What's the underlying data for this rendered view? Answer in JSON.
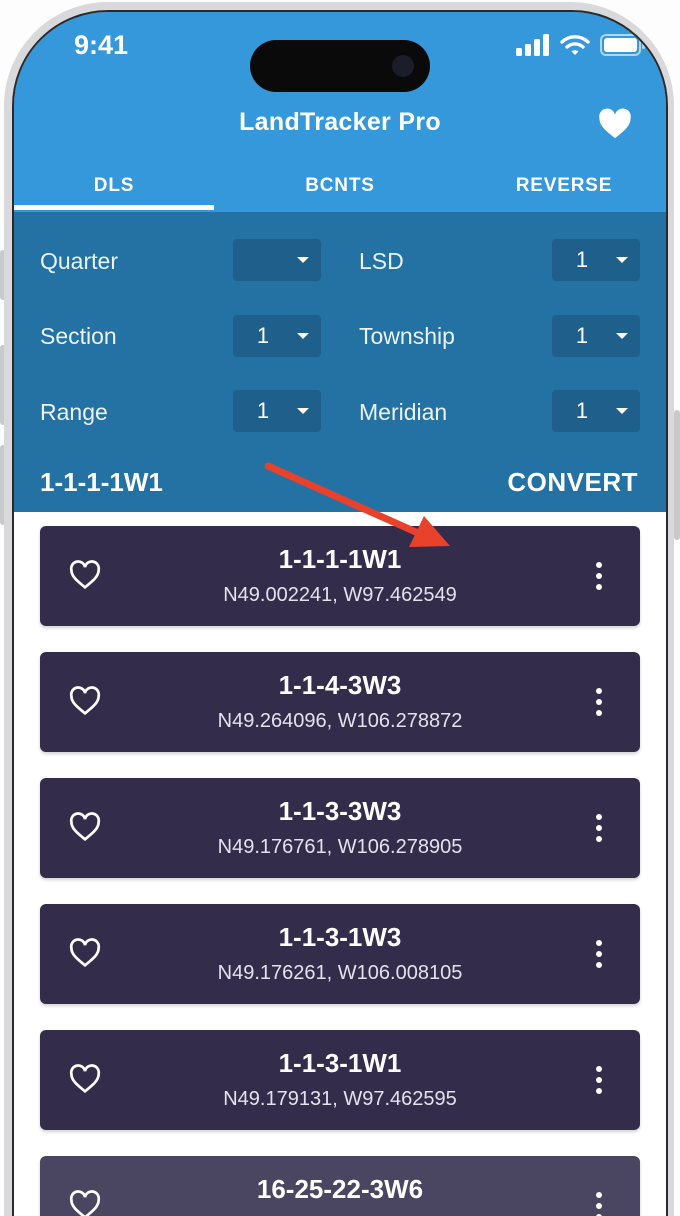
{
  "status_bar": {
    "time": "9:41"
  },
  "app": {
    "title": "LandTracker Pro"
  },
  "icons": {
    "favorite": "heart-filled-icon",
    "card_favorite": "heart-outline-icon",
    "more": "more-vertical-icon"
  },
  "colors": {
    "appbar": "#3498db",
    "form": "#2471a3",
    "select": "#1f5f8b",
    "card": "#332c4a",
    "arrow": "#e8412c"
  },
  "tabs": [
    {
      "label": "DLS",
      "active": true
    },
    {
      "label": "BCNTS",
      "active": false
    },
    {
      "label": "REVERSE",
      "active": false
    }
  ],
  "form": {
    "quarter": {
      "label": "Quarter",
      "value": ""
    },
    "lsd": {
      "label": "LSD",
      "value": "1"
    },
    "section": {
      "label": "Section",
      "value": "1"
    },
    "township": {
      "label": "Township",
      "value": "1"
    },
    "range": {
      "label": "Range",
      "value": "1"
    },
    "meridian": {
      "label": "Meridian",
      "value": "1"
    },
    "result": "1-1-1-1W1",
    "convert_label": "CONVERT"
  },
  "locations": [
    {
      "dls": "1-1-1-1W1",
      "coords": "N49.002241, W97.462549"
    },
    {
      "dls": "1-1-4-3W3",
      "coords": "N49.264096, W106.278872"
    },
    {
      "dls": "1-1-3-3W3",
      "coords": "N49.176761, W106.278905"
    },
    {
      "dls": "1-1-3-1W3",
      "coords": "N49.176261, W106.008105"
    },
    {
      "dls": "1-1-3-1W1",
      "coords": "N49.179131, W97.462595"
    },
    {
      "dls": "16-25-22-3W6",
      "coords": ""
    }
  ]
}
